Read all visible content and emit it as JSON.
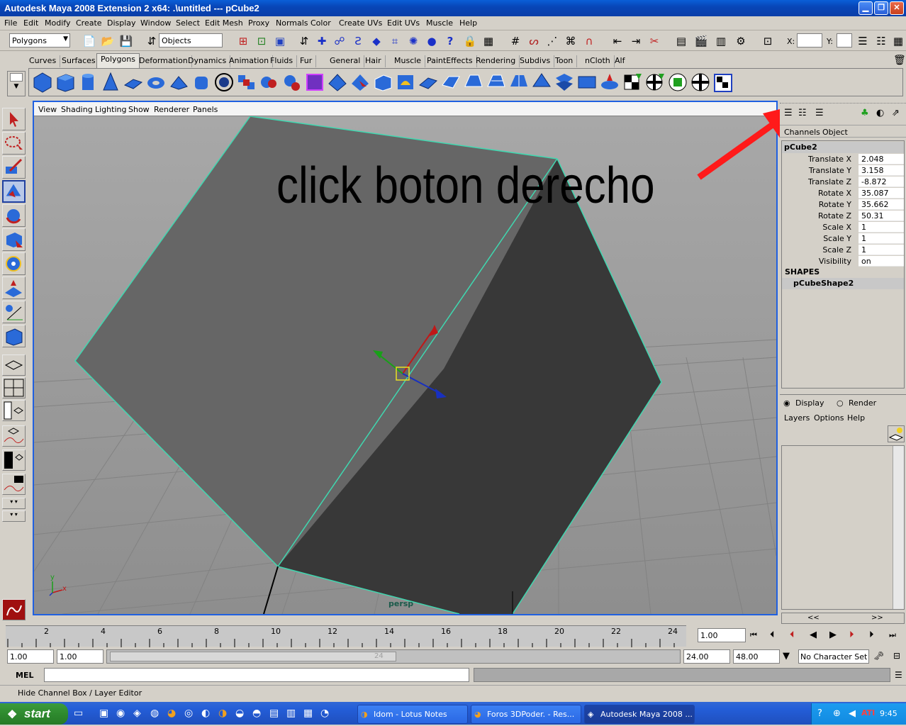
{
  "window": {
    "title": "Autodesk Maya 2008 Extension 2 x64: .\\untitled    ---    pCube2"
  },
  "menubar": [
    "File",
    "Edit",
    "Modify",
    "Create",
    "Display",
    "Window",
    "Select",
    "Edit Mesh",
    "Proxy",
    "Normals",
    "Color",
    "Create UVs",
    "Edit UVs",
    "Muscle",
    "Help"
  ],
  "statusline": {
    "menuset": "Polygons",
    "selection_mode": "Objects",
    "x_label": "X:",
    "y_label": "Y:"
  },
  "shelf_tabs": [
    "Curves",
    "Surfaces",
    "Polygons",
    "Deformation",
    "Dynamics",
    "Animation",
    "Fluids",
    "Fur",
    "General",
    "Hair",
    "Muscle",
    "PaintEffects",
    "Rendering",
    "Subdivs",
    "Toon",
    "nCloth",
    "Alf"
  ],
  "active_shelf": "Polygons",
  "viewport": {
    "menu": [
      "View",
      "Shading",
      "Lighting",
      "Show",
      "Renderer",
      "Panels"
    ],
    "camera_label": "persp",
    "annotation": "click boton derecho",
    "axis_x": "x",
    "axis_y": "y"
  },
  "channel_box": {
    "tabs": [
      "Channels",
      "Object"
    ],
    "object_name": "pCube2",
    "attributes": [
      {
        "label": "Translate X",
        "value": "2.048"
      },
      {
        "label": "Translate Y",
        "value": "3.158"
      },
      {
        "label": "Translate Z",
        "value": "-8.872"
      },
      {
        "label": "Rotate X",
        "value": "35.087"
      },
      {
        "label": "Rotate Y",
        "value": "35.662"
      },
      {
        "label": "Rotate Z",
        "value": "50.31"
      },
      {
        "label": "Scale X",
        "value": "1"
      },
      {
        "label": "Scale Y",
        "value": "1"
      },
      {
        "label": "Scale Z",
        "value": "1"
      },
      {
        "label": "Visibility",
        "value": "on"
      }
    ],
    "shapes_header": "SHAPES",
    "shape_name": "pCubeShape2"
  },
  "layer_editor": {
    "radio_display": "Display",
    "radio_render": "Render",
    "menu": [
      "Layers",
      "Options",
      "Help"
    ],
    "scroll_left": "<<",
    "scroll_right": ">>"
  },
  "timeline": {
    "ticks": [
      "2",
      "4",
      "6",
      "8",
      "10",
      "12",
      "14",
      "16",
      "18",
      "20",
      "22",
      "24"
    ],
    "current_frame": "1.00"
  },
  "range": {
    "start": "1.00",
    "playback_start": "1.00",
    "playback_end": "24.00",
    "end": "48.00",
    "slider_end": "24",
    "character_set": "No Character Set"
  },
  "mel": {
    "label": "MEL"
  },
  "helpline": "Hide Channel Box / Layer Editor",
  "taskbar": {
    "start": "start",
    "tasks": [
      "Idom - Lotus Notes",
      "Foros 3DPoder. - Res...",
      "Autodesk Maya 2008 ..."
    ],
    "clock": "9:45"
  },
  "colors": {
    "annotation_arrow": "#ff1a1a",
    "viewport_border": "#2060e0",
    "cube_light": "#6a6a6a",
    "cube_dark": "#3a3a3a",
    "wireframe": "#3fd8b0"
  }
}
